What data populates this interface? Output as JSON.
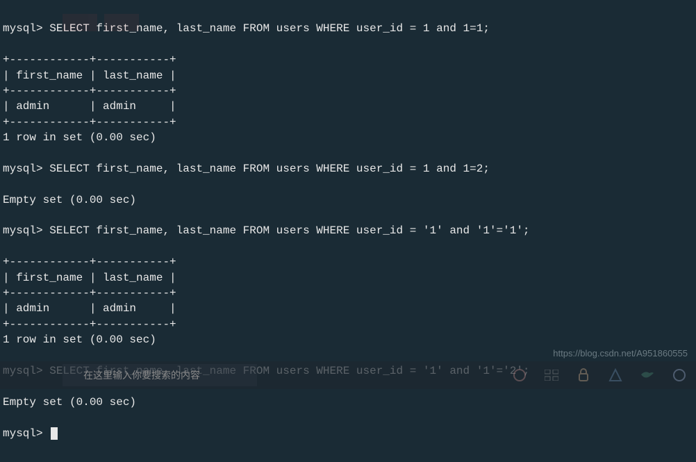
{
  "terminal": {
    "prompt": "mysql>",
    "queries": [
      {
        "sql": "SELECT first_name, last_name FROM users WHERE user_id = 1 and 1=1;",
        "table": {
          "border_top": "+------------+-----------+",
          "header": "| first_name | last_name |",
          "border_mid": "+------------+-----------+",
          "row": "| admin      | admin     |",
          "border_bottom": "+------------+-----------+"
        },
        "result": "1 row in set (0.00 sec)"
      },
      {
        "sql": "SELECT first_name, last_name FROM users WHERE user_id = 1 and 1=2;",
        "result": "Empty set (0.00 sec)"
      },
      {
        "sql": "SELECT first_name, last_name FROM users WHERE user_id = '1' and '1'='1';",
        "table": {
          "border_top": "+------------+-----------+",
          "header": "| first_name | last_name |",
          "border_mid": "+------------+-----------+",
          "row": "| admin      | admin     |",
          "border_bottom": "+------------+-----------+"
        },
        "result": "1 row in set (0.00 sec)"
      },
      {
        "sql": "SELECT first_name, last_name FROM users WHERE user_id = '1' and '1'='2';",
        "result": "Empty set (0.00 sec)"
      }
    ],
    "current_prompt": "mysql>"
  },
  "taskbar": {
    "search_placeholder": "在这里输入你要搜索的内容"
  },
  "watermark": "https://blog.csdn.net/A951860555"
}
